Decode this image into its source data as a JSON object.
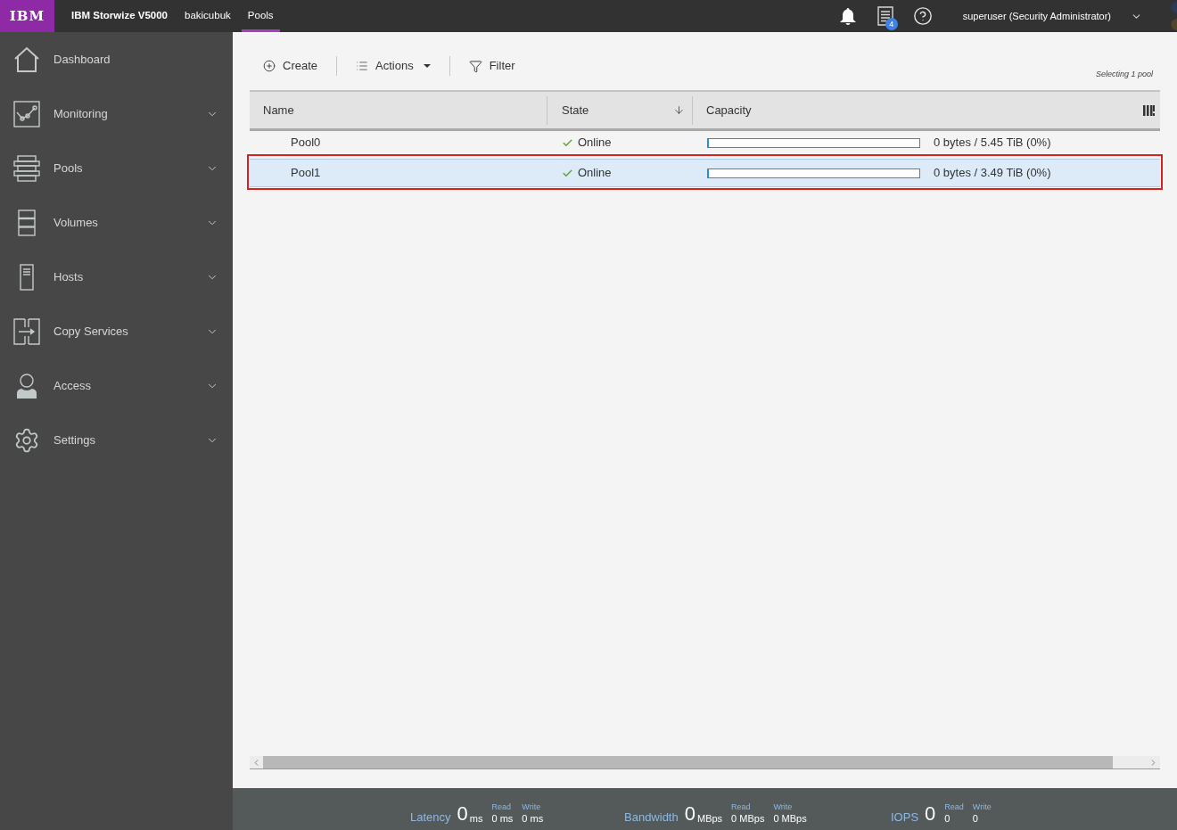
{
  "topbar": {
    "logo_text": "IBM",
    "product": "IBM Storwize V5000",
    "breadcrumbs": [
      {
        "label": "bakicubuk",
        "selected": false
      },
      {
        "label": "Pools",
        "selected": true
      }
    ],
    "notification_badge": "4",
    "user": "superuser (Security Administrator)",
    "corner_dots": [
      {
        "color": "#2c3b5a"
      },
      {
        "color": "#52462a"
      }
    ]
  },
  "sidebar": {
    "items": [
      {
        "kind": "dashboard",
        "label": "Dashboard",
        "has_submenu": false
      },
      {
        "kind": "monitoring",
        "label": "Monitoring",
        "has_submenu": true
      },
      {
        "kind": "pools",
        "label": "Pools",
        "has_submenu": true
      },
      {
        "kind": "volumes",
        "label": "Volumes",
        "has_submenu": true
      },
      {
        "kind": "hosts",
        "label": "Hosts",
        "has_submenu": true
      },
      {
        "kind": "copy",
        "label": "Copy Services",
        "has_submenu": true
      },
      {
        "kind": "access",
        "label": "Access",
        "has_submenu": true
      },
      {
        "kind": "settings",
        "label": "Settings",
        "has_submenu": true
      }
    ]
  },
  "toolbar": {
    "buttons": [
      {
        "kind": "create",
        "label": "Create"
      },
      {
        "kind": "actions",
        "label": "Actions"
      },
      {
        "kind": "filter",
        "label": "Filter"
      }
    ],
    "selection_note": "Selecting 1 pool"
  },
  "table": {
    "columns": [
      {
        "label": "Name",
        "sorted": false
      },
      {
        "label": "State",
        "sorted": true
      },
      {
        "label": "Capacity",
        "sorted": false
      }
    ],
    "rows": [
      {
        "name": "Pool0",
        "state": "Online",
        "capacity": {
          "level": 0,
          "reading": "0 bytes / 5.45 TiB (0%)"
        },
        "selected": false,
        "highlighted": false
      },
      {
        "name": "Pool1",
        "state": "Online",
        "capacity": {
          "level": 0,
          "reading": "0 bytes / 3.49 TiB (0%)"
        },
        "selected": true,
        "highlighted": true
      }
    ]
  },
  "status_bar": {
    "metrics": [
      {
        "label": "Latency",
        "value": "0",
        "unit": "ms",
        "parts": [
          {
            "label": "Read",
            "value": "0 ms"
          },
          {
            "label": "Write",
            "value": "0 ms"
          }
        ]
      },
      {
        "label": "Bandwidth",
        "value": "0",
        "unit": "MBps",
        "parts": [
          {
            "label": "Read",
            "value": "0 MBps"
          },
          {
            "label": "Write",
            "value": "0 MBps"
          }
        ]
      },
      {
        "label": "IOPS",
        "value": "0",
        "parts": [
          {
            "label": "Read",
            "value": "0"
          },
          {
            "label": "Write",
            "value": "0"
          }
        ]
      }
    ]
  }
}
